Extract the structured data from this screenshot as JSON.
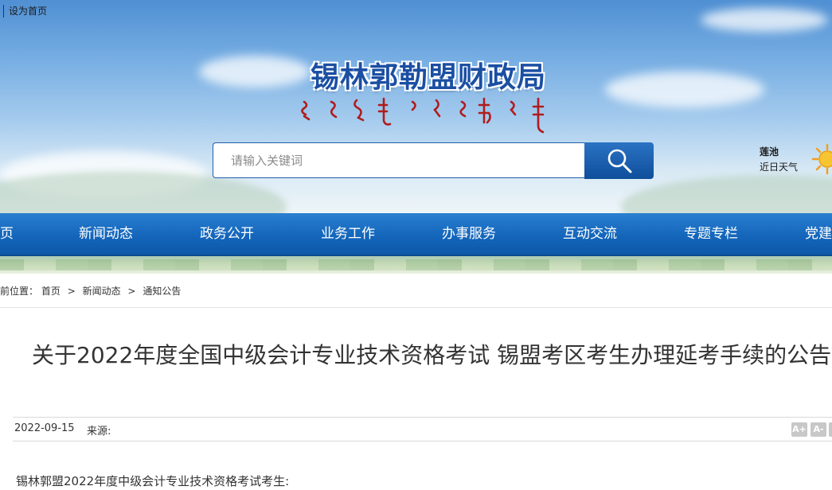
{
  "topbar": {
    "set_homepage": "设为首页"
  },
  "header": {
    "site_title": "锡林郭勒盟财政局",
    "search_placeholder": "请输入关键词",
    "weather": {
      "city": "莲池",
      "label": "近日天气",
      "icon": "sun-icon"
    }
  },
  "nav": {
    "items": [
      "页",
      "新闻动态",
      "政务公开",
      "业务工作",
      "办事服务",
      "互动交流",
      "专题专栏",
      "党建"
    ]
  },
  "breadcrumb": {
    "prefix": "前位置：",
    "items": [
      "首页",
      "新闻动态",
      "通知公告"
    ],
    "separator": ">"
  },
  "article": {
    "title": "关于2022年度全国中级会计专业技术资格考试 锡盟考区考生办理延考手续的公告",
    "date": "2022-09-15",
    "source_label": "来源:",
    "font_increase": "A+",
    "font_decrease": "A-",
    "first_line": "锡林郭盟2022年度中级会计专业技术资格考试考生:"
  },
  "colors": {
    "brand_blue": "#1466bb",
    "title_blue": "#1b4fa3"
  }
}
